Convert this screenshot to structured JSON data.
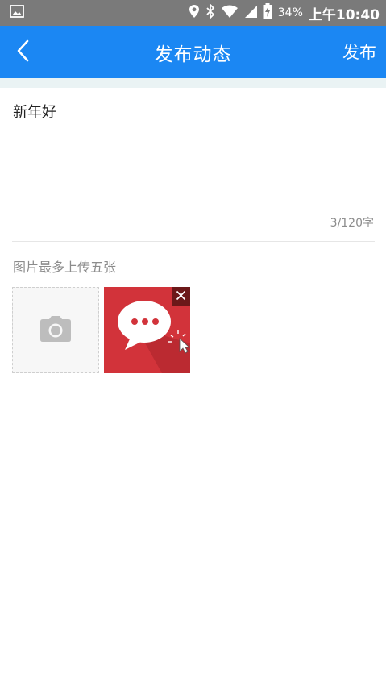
{
  "status_bar": {
    "battery_percent": "34%",
    "time": "上午10:40",
    "icons": [
      "image-icon",
      "location-icon",
      "bluetooth-icon",
      "wifi-icon",
      "signal-icon",
      "battery-charging-icon"
    ]
  },
  "nav": {
    "title": "发布动态",
    "publish_label": "发布",
    "back_icon": "chevron-left-icon",
    "bar_color": "#1b87f3"
  },
  "post": {
    "text": "新年好",
    "char_count": "3/120字"
  },
  "images": {
    "hint": "图片最多上传五张",
    "add_icon": "camera-icon",
    "thumbnails": [
      {
        "icon": "chat-bubble-icon",
        "remove_icon": "close-icon",
        "accent": "#d2333a"
      }
    ]
  }
}
